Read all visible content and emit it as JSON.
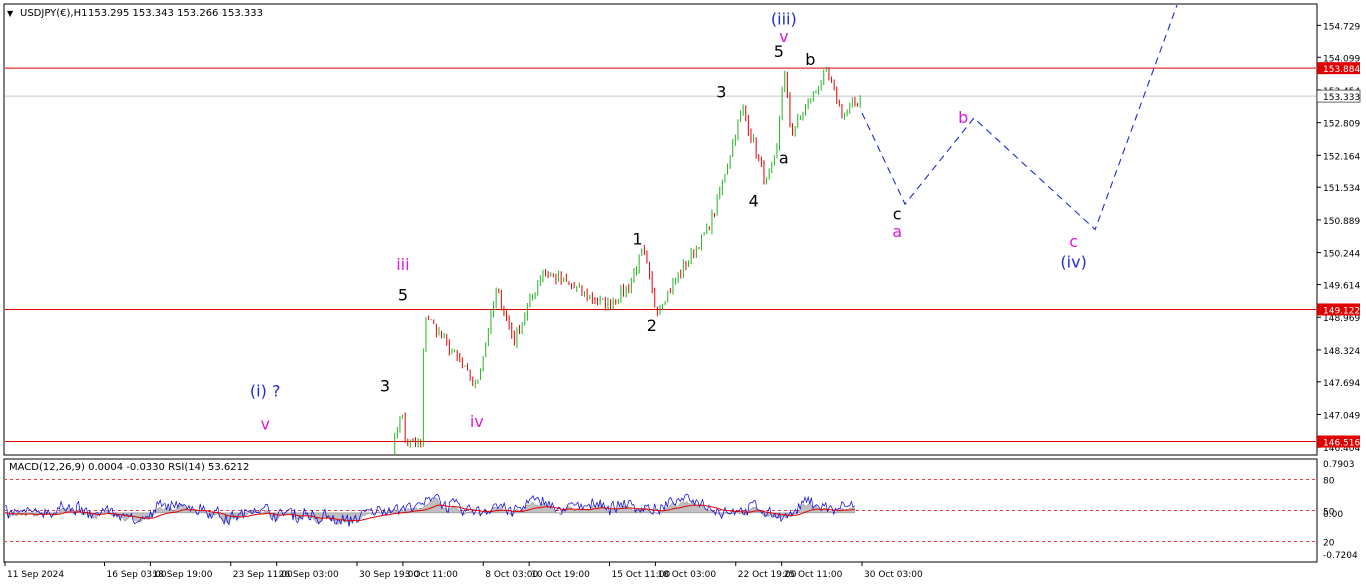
{
  "header": {
    "triangle_icon": "down-triangle-icon",
    "symbol": "USDJPY(€),H1",
    "ohlc": "153.295 153.343 153.266 153.333"
  },
  "indicator_header": "MACD(12,26,9) 0.0004 -0.0330  RSI(14) 53.6212",
  "chart_data": {
    "type": "candlestick",
    "price_ylim": [
      146.25,
      155.15
    ],
    "price_axis_ticks": [
      "154.729",
      "154.099",
      "153.454",
      "152.809",
      "152.164",
      "151.534",
      "150.889",
      "150.244",
      "149.614",
      "148.969",
      "148.324",
      "147.694",
      "147.049",
      "146.404"
    ],
    "x_ticks": [
      "11 Sep 2024",
      "16 Sep 03:00",
      "18 Sep 19:00",
      "23 Sep 11:00",
      "26 Sep 03:00",
      "30 Sep 19:00",
      "3 Oct 11:00",
      "8 Oct 03:00",
      "10 Oct 19:00",
      "15 Oct 11:00",
      "18 Oct 03:00",
      "22 Oct 19:00",
      "25 Oct 11:00",
      "30 Oct 03:00"
    ],
    "horizontal_levels": [
      {
        "value": 153.884,
        "label": "153.884",
        "color": "#e00000"
      },
      {
        "value": 149.122,
        "label": "149.122",
        "color": "#e00000"
      },
      {
        "value": 146.516,
        "label": "146.516",
        "color": "#e00000"
      }
    ],
    "current_price": {
      "value": 153.333,
      "label": "153.333"
    },
    "price_path_anchors": [
      {
        "x": "2 Oct 20:00",
        "price": 146.3
      },
      {
        "x": "3 Oct 09:00",
        "price": 147.2
      },
      {
        "x": "3 Oct 14:00",
        "price": 146.5
      },
      {
        "x": "4 Oct 14:00",
        "price": 146.45
      },
      {
        "x": "4 Oct 16:00",
        "price": 148.9
      },
      {
        "x": "4 Oct 20:00",
        "price": 149.0
      },
      {
        "x": "7 Oct 17:00",
        "price": 147.6
      },
      {
        "x": "8 Oct 22:00",
        "price": 149.5
      },
      {
        "x": "9 Oct 22:00",
        "price": 148.5
      },
      {
        "x": "11 Oct 14:00",
        "price": 149.9
      },
      {
        "x": "15 Oct 06:00",
        "price": 149.2
      },
      {
        "x": "16 Oct 14:00",
        "price": 149.6
      },
      {
        "x": "17 Oct 10:00",
        "price": 150.3
      },
      {
        "x": "18 Oct 04:00",
        "price": 149.1
      },
      {
        "x": "21 Oct 04:00",
        "price": 150.7
      },
      {
        "x": "21 Oct 14:00",
        "price": 151.1
      },
      {
        "x": "23 Oct 04:00",
        "price": 153.1
      },
      {
        "x": "24 Oct 14:00",
        "price": 151.6
      },
      {
        "x": "25 Oct 04:00",
        "price": 152.2
      },
      {
        "x": "25 Oct 14:00",
        "price": 153.9
      },
      {
        "x": "26 Oct 00:00",
        "price": 152.6
      },
      {
        "x": "28 Oct 01:00",
        "price": 153.8
      },
      {
        "x": "29 Oct 00:00",
        "price": 152.95
      },
      {
        "x": "30 Oct 03:00",
        "price": 153.333
      }
    ],
    "projection_path": [
      {
        "x": "30 Oct 03:00",
        "price": 153.0
      },
      {
        "x": "1 Nov 15:00",
        "price": 151.2
      },
      {
        "x": "5 Nov 15:00",
        "price": 152.9
      },
      {
        "x": "12 Nov 16:00",
        "price": 150.7
      },
      {
        "x": "17 Nov 12:00",
        "price": 155.2
      }
    ],
    "wave_labels": [
      {
        "text": "(i) ?",
        "x": "25 Sep 11:00",
        "price": 147.4,
        "color": "#1c2bd6"
      },
      {
        "text": "v",
        "x": "25 Sep 11:00",
        "price": 146.75,
        "color": "#e01ad8"
      },
      {
        "text": "3",
        "x": "2 Oct 10:00",
        "price": 147.5,
        "color": "#000000"
      },
      {
        "text": "iii",
        "x": "3 Oct 11:00",
        "price": 149.9,
        "color": "#e01ad8"
      },
      {
        "text": "5",
        "x": "3 Oct 11:00",
        "price": 149.3,
        "color": "#000000"
      },
      {
        "text": "iv",
        "x": "7 Oct 18:00",
        "price": 146.8,
        "color": "#e01ad8"
      },
      {
        "text": "1",
        "x": "17 Oct 02:00",
        "price": 150.4,
        "color": "#000000"
      },
      {
        "text": "2",
        "x": "17 Oct 22:00",
        "price": 148.7,
        "color": "#000000"
      },
      {
        "text": "3",
        "x": "21 Oct 23:00",
        "price": 153.3,
        "color": "#000000"
      },
      {
        "text": "4",
        "x": "23 Oct 20:00",
        "price": 151.15,
        "color": "#000000"
      },
      {
        "text": "5",
        "x": "25 Oct 07:00",
        "price": 154.1,
        "color": "#000000"
      },
      {
        "text": "v",
        "x": "25 Oct 14:00",
        "price": 154.4,
        "color": "#e01ad8"
      },
      {
        "text": "(iii)",
        "x": "25 Oct 14:00",
        "price": 154.75,
        "color": "#1c2bd6"
      },
      {
        "text": "b",
        "x": "27 Oct 03:00",
        "price": 153.95,
        "color": "#000000"
      },
      {
        "text": "a",
        "x": "25 Oct 14:00",
        "price": 152.0,
        "color": "#000000"
      },
      {
        "text": "c",
        "x": "1 Nov 04:00",
        "price": 150.9,
        "color": "#000000"
      },
      {
        "text": "a",
        "x": "1 Nov 04:00",
        "price": 150.55,
        "color": "#e01ad8"
      },
      {
        "text": "b",
        "x": "5 Nov 00:00",
        "price": 152.8,
        "color": "#e01ad8"
      },
      {
        "text": "c",
        "x": "11 Nov 10:00",
        "price": 150.35,
        "color": "#e01ad8"
      },
      {
        "text": "(iv)",
        "x": "11 Nov 10:00",
        "price": 149.95,
        "color": "#1c2bd6"
      }
    ],
    "indicator": {
      "macd": {
        "value": 0.0004,
        "signal": -0.033
      },
      "rsi": {
        "value": 53.6212
      },
      "axis_ticks": [
        "0.7903",
        "80",
        "50",
        "0.00",
        "20",
        "-0.7204"
      ],
      "levels": [
        80,
        50,
        20
      ],
      "histogram_color": "#c0c0c0",
      "rsi_color": "#0000e0",
      "signal_color": "#e00000"
    },
    "colors": {
      "bull": "#22b422",
      "bear": "#e00000",
      "projection": "#1c2bd6"
    }
  }
}
